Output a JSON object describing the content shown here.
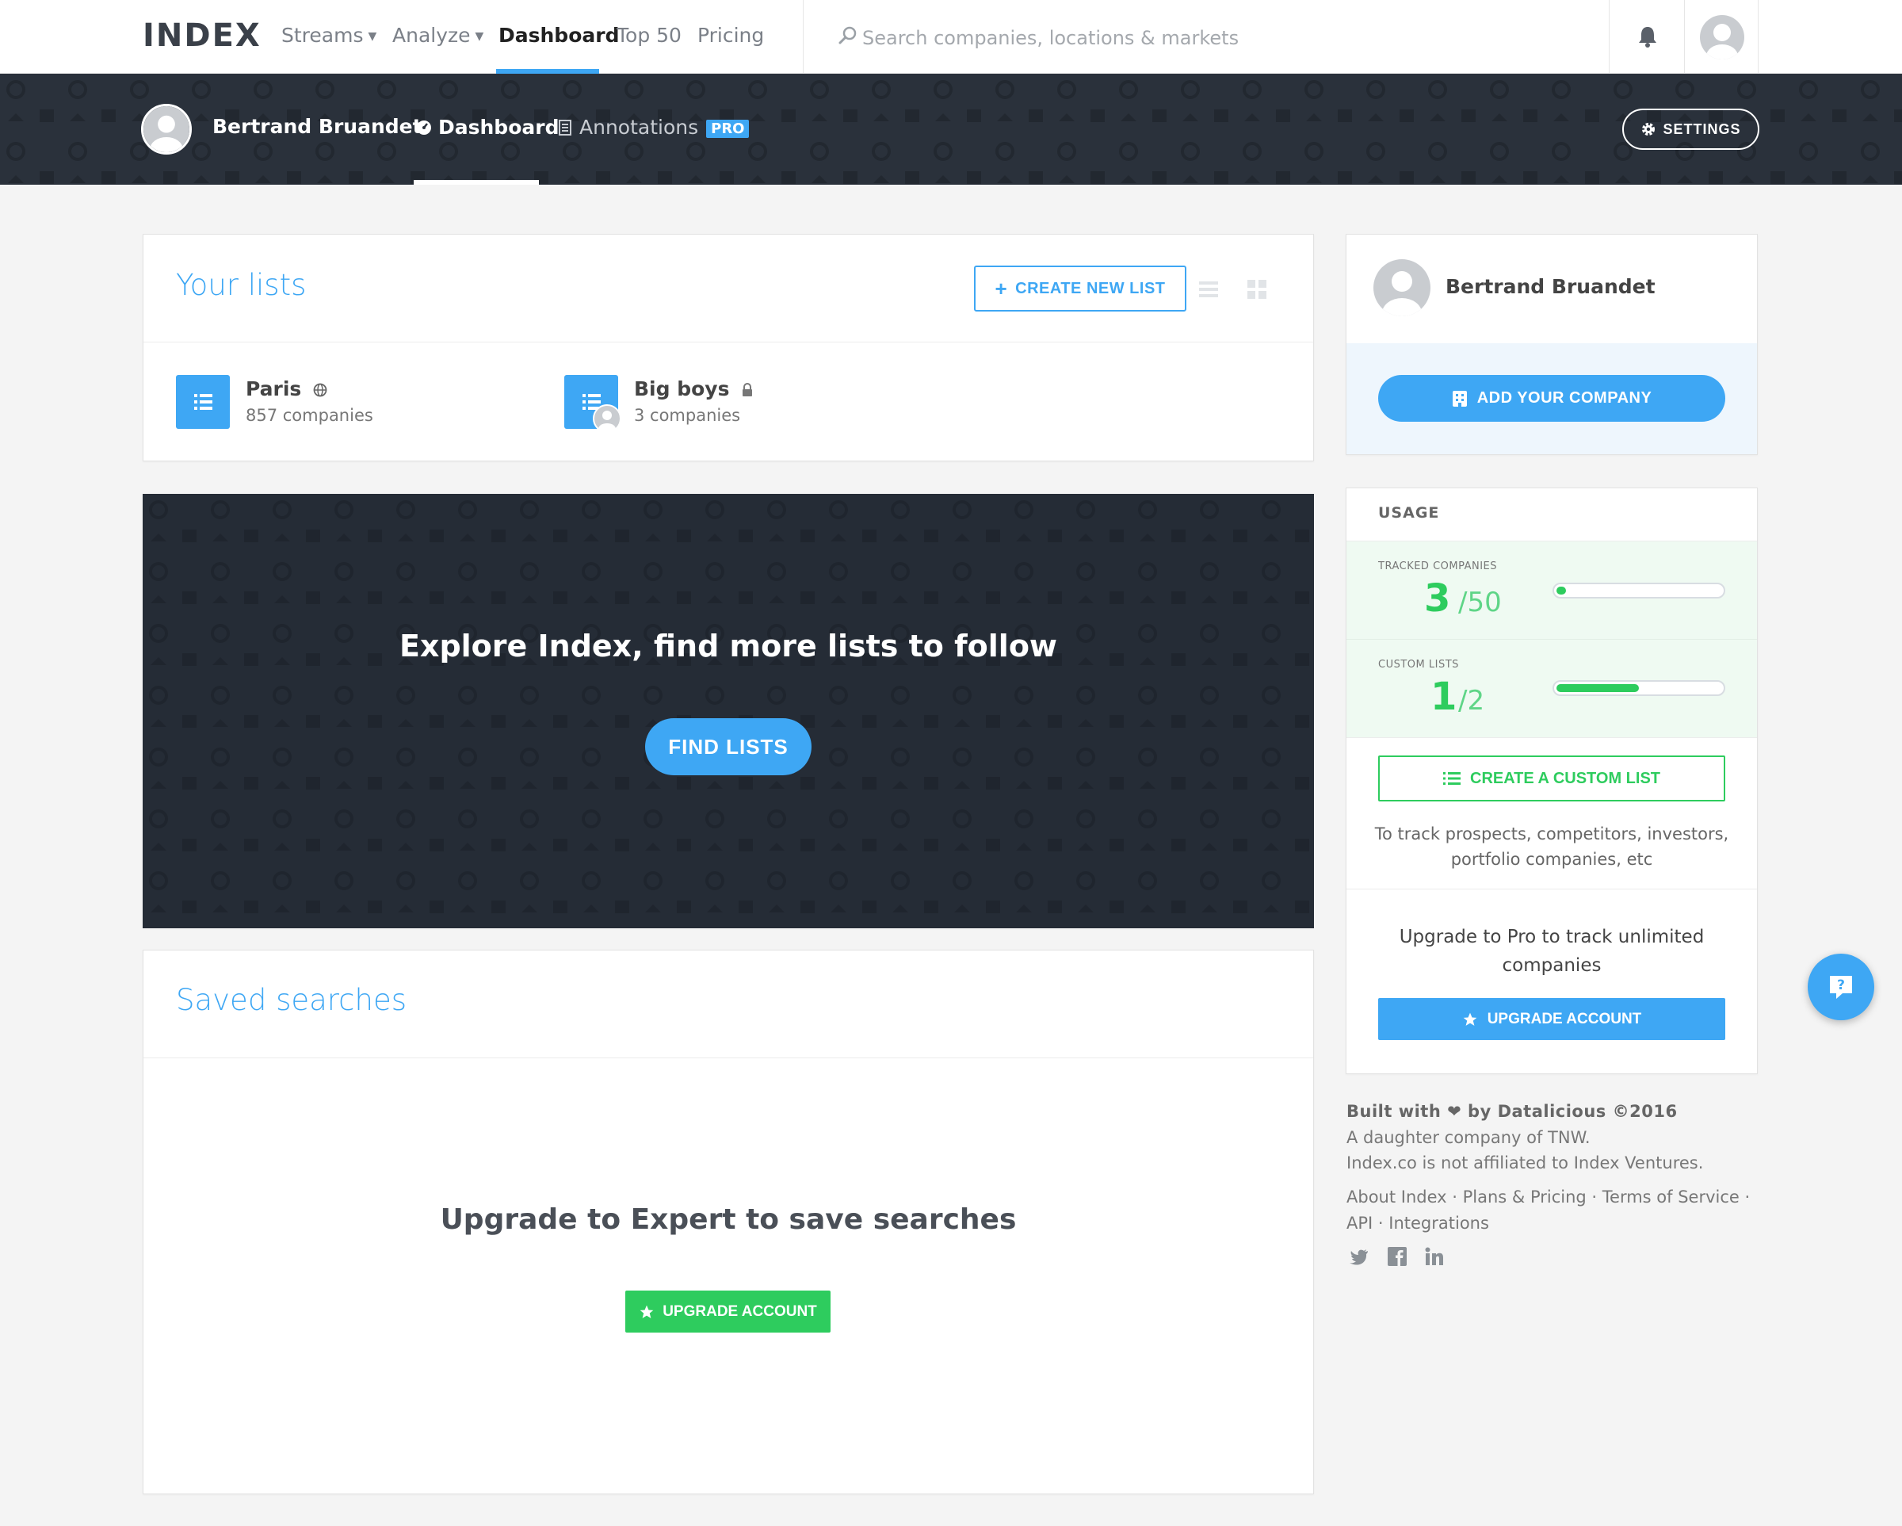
{
  "nav": {
    "logo": "INDEX",
    "items": [
      {
        "label": "Streams",
        "has_caret": true
      },
      {
        "label": "Analyze",
        "has_caret": true
      },
      {
        "label": "Dashboard",
        "active": true
      },
      {
        "label": "Top 50"
      },
      {
        "label": "Pricing"
      }
    ],
    "search_placeholder": "Search companies, locations & markets",
    "icons": [
      "search-icon",
      "bell-icon",
      "avatar"
    ]
  },
  "subnav": {
    "user_name": "Bertrand Bruandet",
    "tabs": [
      {
        "label": "Dashboard",
        "icon": "dashboard-icon",
        "active": true
      },
      {
        "label": "Annotations",
        "icon": "document-icon",
        "badge": "PRO"
      }
    ],
    "settings_label": "SETTINGS"
  },
  "lists": {
    "title": "Your lists",
    "create_label": "CREATE NEW LIST",
    "items": [
      {
        "name": "Paris",
        "count": "857 companies",
        "visibility_icon": "globe-icon"
      },
      {
        "name": "Big boys",
        "count": "3 companies",
        "visibility_icon": "lock-icon"
      }
    ]
  },
  "explore": {
    "title": "Explore Index, find more lists to follow",
    "button": "FIND LISTS"
  },
  "saved": {
    "title": "Saved searches",
    "upgrade_title": "Upgrade to Expert to save searches",
    "button": "UPGRADE ACCOUNT"
  },
  "profile": {
    "name": "Bertrand Bruandet",
    "add_company": "ADD YOUR COMPANY"
  },
  "usage": {
    "label": "USAGE",
    "tracked": {
      "caption": "TRACKED COMPANIES",
      "value": "3",
      "max": "/50",
      "fraction": 0.06
    },
    "custom": {
      "caption": "CUSTOM LISTS",
      "value": "1",
      "max": "/2",
      "fraction": 0.5
    },
    "create_custom": "CREATE A CUSTOM LIST",
    "track_text": "To track prospects, competitors, investors, portfolio companies, etc",
    "upgrade_text": "Upgrade to Pro to track unlimited companies",
    "upgrade_button": "UPGRADE ACCOUNT"
  },
  "footer": {
    "built_prefix": "Built with",
    "built_suffix": "by Datalicious ©2016",
    "line1": "A daughter company of TNW.",
    "line2": "Index.co is not affiliated to Index Ventures.",
    "links1": [
      "About Index",
      "Plans & Pricing",
      "Terms of Service"
    ],
    "links2": [
      "API",
      "Integrations"
    ],
    "social": [
      "twitter-icon",
      "facebook-icon",
      "linkedin-icon"
    ]
  },
  "colors": {
    "accent": "#3ea7f4",
    "success": "#2ecc5e",
    "dark": "#2a313b"
  }
}
